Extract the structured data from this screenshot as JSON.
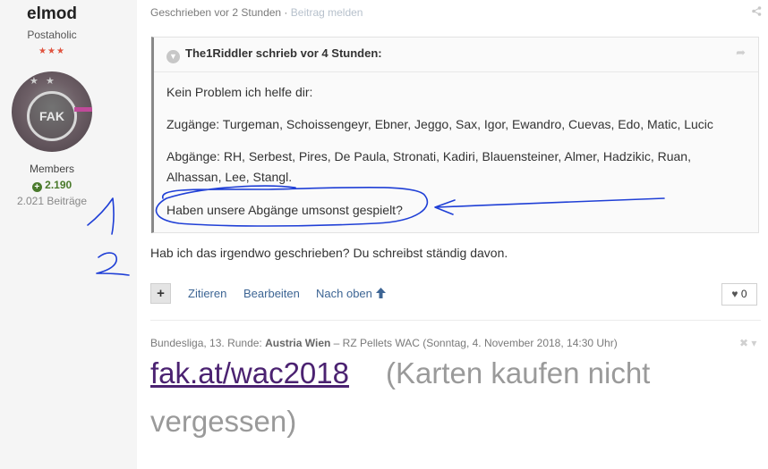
{
  "author": {
    "username": "elmod",
    "title": "Postaholic",
    "stars": "★★★",
    "group": "Members",
    "reputation": "2.190",
    "posts": "2.021 Beiträge",
    "avatar_text": "FAK"
  },
  "post": {
    "meta_time": "Geschrieben vor 2 Stunden",
    "meta_sep": " · ",
    "meta_report": "Beitrag melden",
    "body": "Hab ich das irgendwo geschrieben? Du schreibst ständig davon."
  },
  "quote": {
    "header": "The1Riddler schrieb vor 4 Stunden:",
    "lines": [
      "Kein Problem ich helfe dir:",
      "Zugänge: Turgeman, Schoissengeyr, Ebner, Jeggo, Sax, Igor, Ewandro, Cuevas, Edo, Matic, Lucic",
      "Abgänge: RH, Serbest, Pires, De Paula, Stronati, Kadiri, Blauensteiner, Almer, Hadzikic, Ruan, Alhassan, Lee, Stangl.",
      "Haben unsere Abgänge umsonst gespielt?"
    ]
  },
  "controls": {
    "plus": "+",
    "quote": "Zitieren",
    "edit": "Bearbeiten",
    "top": "Nach oben",
    "likes": "0"
  },
  "signature": {
    "prefix": "Bundesliga, 13. Runde: ",
    "team": "Austria Wien",
    "rest": " – RZ Pellets WAC (Sonntag, 4. November 2018, 14:30 Uhr)",
    "link": "fak.at/wac2018",
    "text1": "(Karten kaufen nicht",
    "text2": "vergessen)"
  },
  "colors": {
    "accent_link": "#3d6594",
    "signature_link": "#4b2271",
    "reputation": "#4a7a2c",
    "annotation_ink": "#1f3fd6"
  }
}
